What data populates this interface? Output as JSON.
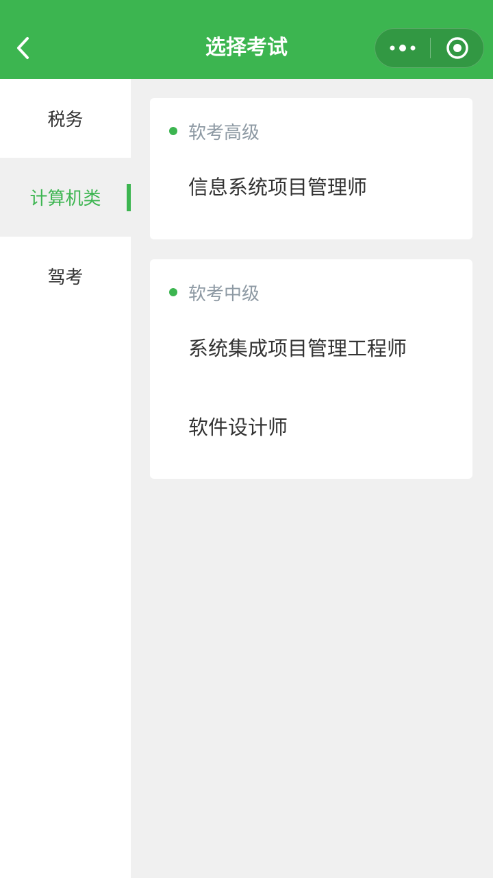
{
  "navbar": {
    "title": "选择考试",
    "back_icon": "chevron-left-icon",
    "more_icon": "more-dots-icon",
    "close_icon": "target-close-icon",
    "color": "#3cb550"
  },
  "sidebar": {
    "items": [
      {
        "label": "税务",
        "active": false
      },
      {
        "label": "计算机类",
        "active": true
      },
      {
        "label": "驾考",
        "active": false
      }
    ]
  },
  "groups": [
    {
      "title": "软考高级",
      "exams": [
        "信息系统项目管理师"
      ]
    },
    {
      "title": "软考中级",
      "exams": [
        "系统集成项目管理工程师",
        "软件设计师"
      ]
    }
  ],
  "colors": {
    "accent": "#3cb550",
    "text": "#333333",
    "group_title": "#8d99a3",
    "background": "#f0f0f0"
  }
}
